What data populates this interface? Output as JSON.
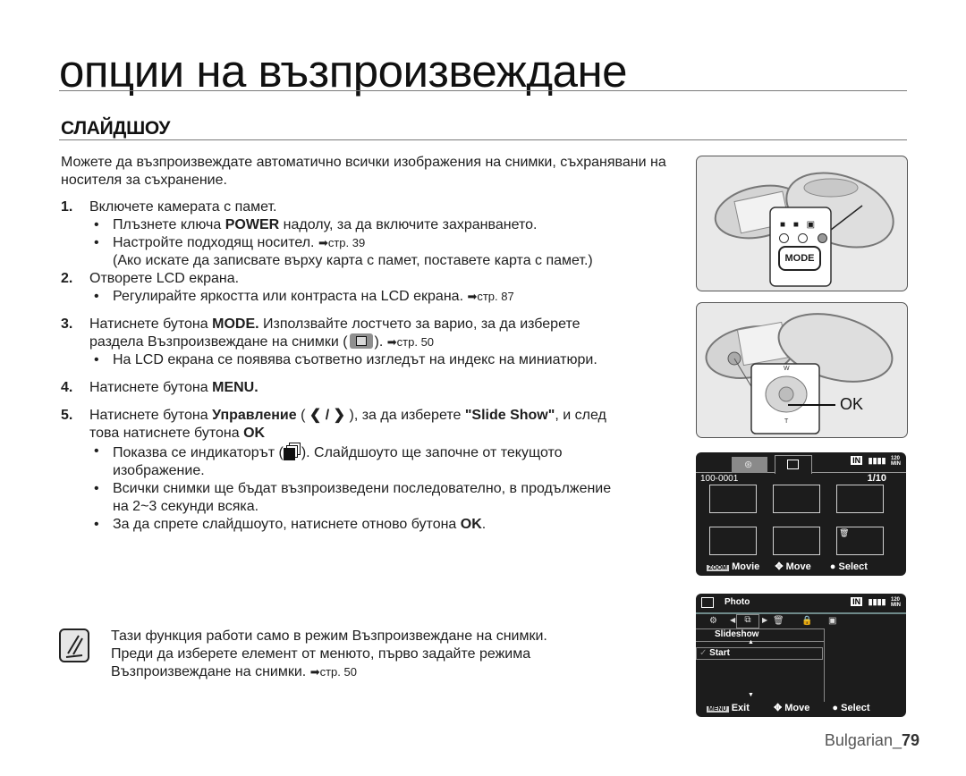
{
  "page": {
    "title": "опции на възпроизвеждане",
    "section_title": "СЛАЙДШОУ"
  },
  "body": {
    "intro": "Можете да възпроизвеждате автоматично всички изображения на снимки, съхранявани на носителя за съхранение.",
    "steps": [
      {
        "num": "1.",
        "text": "Включете камерата с памет.",
        "bullets": [
          {
            "pre": "Плъзнете ключа ",
            "bold": "POWER",
            "post": " надолу, за да включите захранването."
          },
          {
            "pre": "Настройте подходящ носител. ",
            "ref": "➡стр. 39",
            "cont": "(Ако искате да записвате върху карта с памет, поставете карта с памет.)"
          }
        ]
      },
      {
        "num": "2.",
        "text": "Отворете LCD екрана.",
        "bullets": [
          {
            "pre": "Регулирайте яркостта или контраста на LCD екрана. ",
            "ref": "➡стр. 87"
          }
        ]
      },
      {
        "num": "3.",
        "pre": "Натиснете бутона ",
        "bold": "MODE.",
        "post": " Използвайте лостчето за варио, за да изберете",
        "line2_pre": "раздела Възпроизвеждане на снимки (",
        "line2_post": "). ",
        "ref": "➡стр. 50",
        "bullets": [
          {
            "pre": "На LCD екрана се появява съответно изгледът на индекс на миниатюри."
          }
        ]
      },
      {
        "num": "4.",
        "pre": "Натиснете бутона ",
        "bold": "MENU."
      },
      {
        "num": "5.",
        "pre": "Натиснете бутона ",
        "bold": "Управление",
        "mid": " ( ",
        "arrows": "❮ / ❯",
        "mid2": " ), за да изберете ",
        "bold2": "\"Slide Show\"",
        "post": ", и след",
        "line2_pre": "това натиснете бутона ",
        "line2_bold": "OK",
        "bullets": [
          {
            "pre": "Показва се индикаторът (",
            "post": "). Слайдшоуто ще започне от текущото",
            "cont": "изображение."
          },
          {
            "pre": "Всички снимки ще бъдат възпроизведени последователно, в продължение",
            "cont": "на 2~3 секунди всяка."
          },
          {
            "pre": "За да спрете слайдшоуто, натиснете отново бутона ",
            "bold": "OK",
            "post": "."
          }
        ]
      }
    ],
    "bullet_char": "•"
  },
  "note": {
    "icon": "note-pencil-icon",
    "lines": [
      "Тази функция работи само в режим Възпроизвеждане на снимки.",
      "Преди да изберете елемент от менюто, първо задайте режима",
      "Възпроизвеждане на снимки. "
    ],
    "ref": "➡стр. 50"
  },
  "figures": {
    "mode_button": {
      "label": "MODE",
      "icons": [
        "movie-camera-icon",
        "photo-camera-icon",
        "playback-icon"
      ]
    },
    "joystick": {
      "ok_label": "OK",
      "w": "W",
      "t": "T"
    }
  },
  "lcd_index": {
    "tabs": [
      "movie-tab",
      "photo-tab"
    ],
    "status": {
      "storage": "IN",
      "time_top": "120",
      "time_bottom": "MIN"
    },
    "file_no": "100-0001",
    "counter": "1/10",
    "thumbnails": 6,
    "footer": {
      "zoom_key": "ZOOM",
      "zoom_label": "Movie",
      "move_label": "Move",
      "select_label": "Select"
    }
  },
  "lcd_menu": {
    "title": "Photo",
    "status": {
      "storage": "IN",
      "time_top": "120",
      "time_bottom": "MIN"
    },
    "menu_title": "Slideshow",
    "item": "Start",
    "check": "✓",
    "footer": {
      "menu_key": "MENU",
      "exit_label": "Exit",
      "move_label": "Move",
      "select_label": "Select"
    }
  },
  "footer": {
    "language": "Bulgarian_",
    "page_number": "79"
  }
}
